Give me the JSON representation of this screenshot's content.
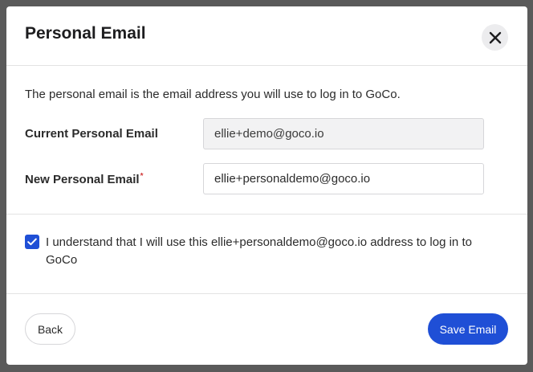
{
  "modal": {
    "title": "Personal Email",
    "intro": "The personal email is the email address you will use to log in to GoCo.",
    "current_email": {
      "label": "Current Personal Email",
      "value": "ellie+demo@goco.io"
    },
    "new_email": {
      "label": "New Personal Email",
      "required_marker": "*",
      "value": "ellie+personaldemo@goco.io"
    },
    "confirm": {
      "checked": true,
      "text": "I understand that I will use this ellie+personaldemo@goco.io address to log in to GoCo"
    },
    "back_label": "Back",
    "save_label": "Save Email"
  },
  "icons": {
    "close": "close-icon",
    "check": "checkmark-icon"
  },
  "colors": {
    "accent": "#1f4fd6",
    "required": "#d23b3b",
    "overlay": "#5a5a5a"
  }
}
